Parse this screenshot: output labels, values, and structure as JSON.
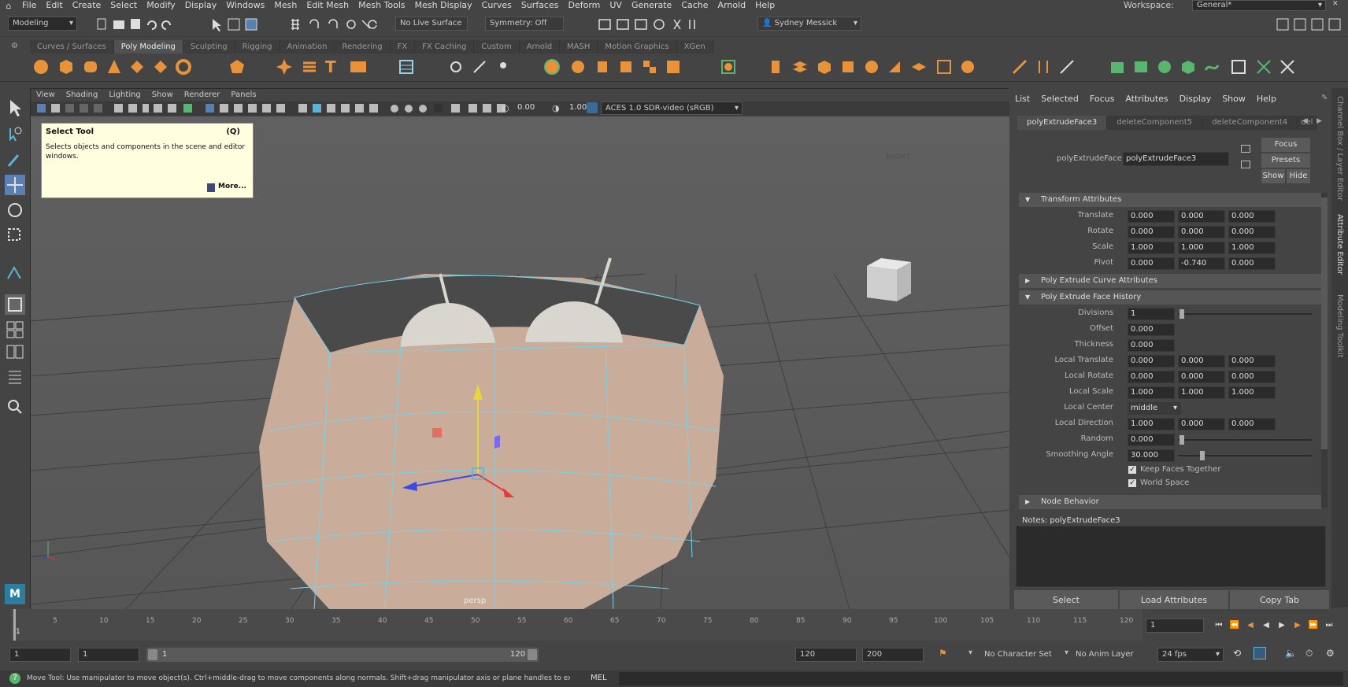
{
  "menubar": {
    "items": [
      "File",
      "Edit",
      "Create",
      "Select",
      "Modify",
      "Display",
      "Windows",
      "Mesh",
      "Edit Mesh",
      "Mesh Tools",
      "Mesh Display",
      "Curves",
      "Surfaces",
      "Deform",
      "UV",
      "Generate",
      "Cache",
      "Arnold",
      "Help"
    ],
    "workspace_label": "Workspace:",
    "workspace_value": "General*"
  },
  "statusline": {
    "mode": "Modeling",
    "live_surface": "No Live Surface",
    "symmetry": "Symmetry: Off",
    "user": "Sydney Messick"
  },
  "shelf": {
    "tabs": [
      "Curves / Surfaces",
      "Poly Modeling",
      "Sculpting",
      "Rigging",
      "Animation",
      "Rendering",
      "FX",
      "FX Caching",
      "Custom",
      "Arnold",
      "MASH",
      "Motion Graphics",
      "XGen"
    ],
    "active_tab": "Poly Modeling"
  },
  "viewport": {
    "menu": [
      "View",
      "Shading",
      "Lighting",
      "Show",
      "Renderer",
      "Panels"
    ],
    "exposure": "0.00",
    "gamma": "1.00",
    "colorspace": "ACES 1.0 SDR-video (sRGB)",
    "camera_label": "persp",
    "viewcube_label": "RIGHT"
  },
  "tooltip": {
    "title": "Select Tool",
    "hotkey": "(Q)",
    "body": "Selects objects and components in the scene and editor windows.",
    "more": "More..."
  },
  "attribute_editor": {
    "menu": [
      "List",
      "Selected",
      "Focus",
      "Attributes",
      "Display",
      "Show",
      "Help"
    ],
    "tabs": [
      "polyExtrudeFace3",
      "deleteComponent5",
      "deleteComponent4",
      "del"
    ],
    "node_label": "polyExtrudeFace:",
    "node_value": "polyExtrudeFace3",
    "buttons": {
      "focus": "Focus",
      "presets": "Presets",
      "show": "Show",
      "hide": "Hide"
    },
    "transform": {
      "title": "Transform Attributes",
      "rows": [
        {
          "label": "Translate",
          "values": [
            "0.000",
            "0.000",
            "0.000"
          ]
        },
        {
          "label": "Rotate",
          "values": [
            "0.000",
            "0.000",
            "0.000"
          ]
        },
        {
          "label": "Scale",
          "values": [
            "1.000",
            "1.000",
            "1.000"
          ]
        },
        {
          "label": "Pivot",
          "values": [
            "0.000",
            "-0.740",
            "0.000"
          ]
        }
      ]
    },
    "curve_section": "Poly Extrude Curve Attributes",
    "history": {
      "title": "Poly Extrude Face History",
      "divisions_label": "Divisions",
      "divisions": "1",
      "offset_label": "Offset",
      "offset": "0.000",
      "thickness_label": "Thickness",
      "thickness": "0.000",
      "local_translate_label": "Local Translate",
      "local_translate": [
        "0.000",
        "0.000",
        "0.000"
      ],
      "local_rotate_label": "Local Rotate",
      "local_rotate": [
        "0.000",
        "0.000",
        "0.000"
      ],
      "local_scale_label": "Local Scale",
      "local_scale": [
        "1.000",
        "1.000",
        "1.000"
      ],
      "local_center_label": "Local Center",
      "local_center": "middle",
      "local_direction_label": "Local Direction",
      "local_direction": [
        "1.000",
        "0.000",
        "0.000"
      ],
      "random_label": "Random",
      "random": "0.000",
      "smoothing_label": "Smoothing Angle",
      "smoothing": "30.000",
      "keep_faces": "Keep Faces Together",
      "world_space": "World Space"
    },
    "node_behavior": "Node Behavior",
    "notes_label": "Notes:  polyExtrudeFace3",
    "bottom_buttons": [
      "Select",
      "Load Attributes",
      "Copy Tab"
    ]
  },
  "side_tabs": [
    "Channel Box / Layer Editor",
    "Attribute Editor",
    "Modeling Toolkit"
  ],
  "timeline": {
    "ticks": [
      "5",
      "10",
      "15",
      "20",
      "25",
      "30",
      "35",
      "40",
      "45",
      "50",
      "55",
      "60",
      "65",
      "70",
      "75",
      "80",
      "85",
      "90",
      "95",
      "100",
      "105",
      "110",
      "115",
      "120"
    ],
    "start_marker": "1",
    "current_frame": "1"
  },
  "range": {
    "start": "1",
    "playback_start": "1",
    "slider_start": "1",
    "slider_end": "120",
    "playback_end": "120",
    "end": "200",
    "character_set": "No Character Set",
    "anim_layer": "No Anim Layer",
    "fps": "24 fps"
  },
  "command": {
    "help": "Move Tool: Use manipulator to move object(s). Ctrl+middle-drag to move components along normals. Shift+drag manipulator axis or plane handles to extrude components or c",
    "language": "MEL"
  },
  "colors": {
    "accent": "#5ab4d6",
    "tooltip_bg": "#ffffe0",
    "icon_orange": "#e8923a",
    "icon_green": "#5ab56e",
    "mesh_face": "#c9ad9a",
    "wire": "#74d4ec"
  }
}
